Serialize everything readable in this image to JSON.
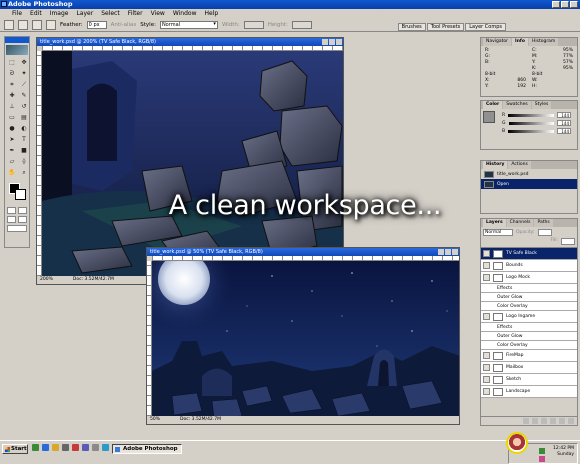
{
  "app": {
    "title": "Adobe Photoshop"
  },
  "menu": [
    "File",
    "Edit",
    "Image",
    "Layer",
    "Select",
    "Filter",
    "View",
    "Window",
    "Help"
  ],
  "options": {
    "feather_label": "Feather:",
    "feather_value": "0 px",
    "antialias_label": "Anti-alias",
    "style_label": "Style:",
    "style_value": "Normal",
    "width_label": "Width:",
    "height_label": "Height:"
  },
  "palette_well": [
    "Brushes",
    "Tool Presets",
    "Layer Comps"
  ],
  "doc1": {
    "title": "title_work.psd @ 200% (TV Safe Black, RGB/8)",
    "zoom": "200%",
    "doc_size": "Doc: 3.52M/42.7M"
  },
  "doc2": {
    "title": "title_work.psd @ 50% (TV Safe Black, RGB/8)",
    "zoom": "50%",
    "doc_size": "Doc: 3.52M/42.7M"
  },
  "info_panel": {
    "tabs": [
      "Navigator",
      "Info",
      "Histogram"
    ],
    "rows": [
      {
        "l": "R:",
        "v": "",
        "l2": "C:",
        "v2": "95%"
      },
      {
        "l": "G:",
        "v": "",
        "l2": "M:",
        "v2": "77%"
      },
      {
        "l": "B:",
        "v": "",
        "l2": "Y:",
        "v2": "57%"
      },
      {
        "l": "",
        "v": "",
        "l2": "K:",
        "v2": "95%"
      },
      {
        "l": "8-bit",
        "v": "",
        "l2": "8-bit",
        "v2": ""
      },
      {
        "l": "X:",
        "v": "860",
        "l2": "W:",
        "v2": ""
      },
      {
        "l": "Y:",
        "v": "192",
        "l2": "H:",
        "v2": ""
      }
    ]
  },
  "color_panel": {
    "tabs": [
      "Color",
      "Swatches",
      "Styles"
    ],
    "sliders": [
      {
        "label": "R",
        "value": "144"
      },
      {
        "label": "G",
        "value": "144"
      },
      {
        "label": "B",
        "value": "144"
      }
    ]
  },
  "history_panel": {
    "tabs": [
      "History",
      "Actions"
    ],
    "items": [
      {
        "label": "title_work.psd",
        "selected": false
      },
      {
        "label": "Open",
        "selected": true
      }
    ]
  },
  "layers_panel": {
    "tabs": [
      "Layers",
      "Channels",
      "Paths"
    ],
    "blend_mode": "Normal",
    "opacity_label": "Opacity:",
    "fill_label": "Fill:",
    "layers": [
      {
        "label": "TV Safe Black",
        "kind": "layer",
        "selected": true
      },
      {
        "label": "Bounds",
        "kind": "layer"
      },
      {
        "label": "Logo Mock",
        "kind": "layer"
      },
      {
        "label": "Effects",
        "kind": "sub"
      },
      {
        "label": "Outer Glow",
        "kind": "sub"
      },
      {
        "label": "Color Overlay",
        "kind": "sub"
      },
      {
        "label": "Logo Ingame",
        "kind": "layer"
      },
      {
        "label": "Effects",
        "kind": "sub"
      },
      {
        "label": "Outer Glow",
        "kind": "sub"
      },
      {
        "label": "Color Overlay",
        "kind": "sub"
      },
      {
        "label": "FireMap",
        "kind": "layer"
      },
      {
        "label": "Mailbox",
        "kind": "layer"
      },
      {
        "label": "Sketch",
        "kind": "layer"
      },
      {
        "label": "Landscape",
        "kind": "layer"
      }
    ]
  },
  "taskbar": {
    "start": "Start",
    "task": "Adobe Photoshop",
    "time": "12:42 PM",
    "day": "Sunday"
  },
  "caption": "A clean workspace..."
}
